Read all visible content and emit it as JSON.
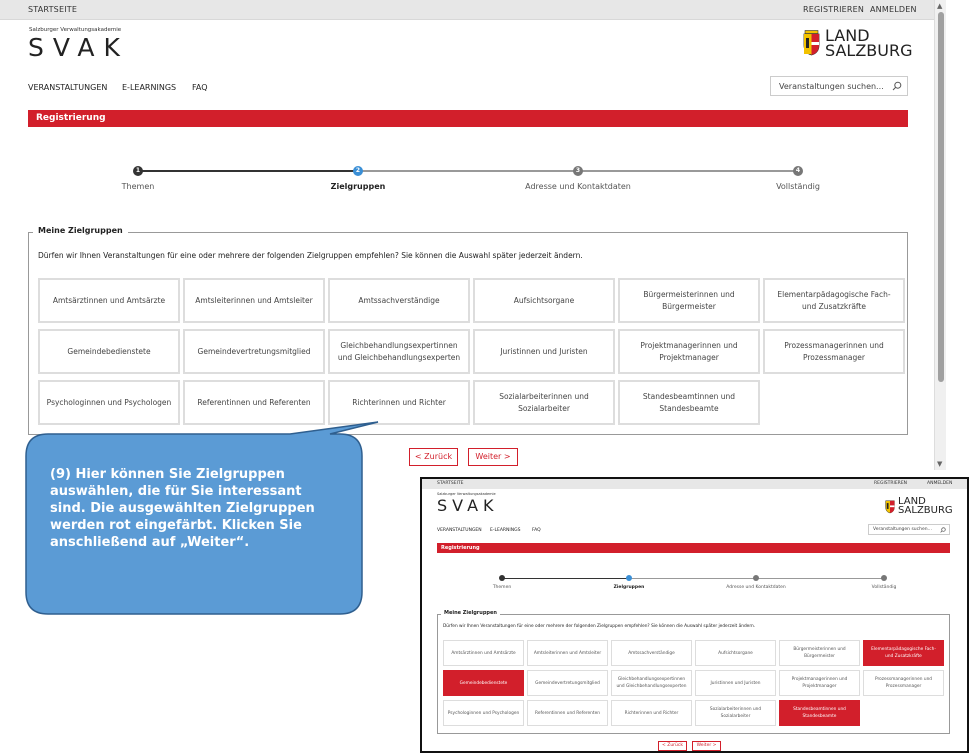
{
  "topbar": {
    "home": "STARTSEITE",
    "register": "REGISTRIEREN",
    "login": "ANMELDEN"
  },
  "logo": {
    "subtitle": "Salzburger Verwaltungsakademie",
    "name": "SVAK"
  },
  "land_logo": {
    "line1": "LAND",
    "line2": "SALZBURG"
  },
  "nav": {
    "items": [
      "VERANSTALTUNGEN",
      "E-LEARNINGS",
      "FAQ"
    ]
  },
  "search": {
    "placeholder": "Veranstaltungen suchen..."
  },
  "section_title": "Registrierung",
  "steps": [
    {
      "num": "1",
      "label": "Themen",
      "state": "done"
    },
    {
      "num": "2",
      "label": "Zielgruppen",
      "state": "active"
    },
    {
      "num": "3",
      "label": "Adresse und Kontaktdaten",
      "state": "todo"
    },
    {
      "num": "4",
      "label": "Vollständig",
      "state": "todo"
    }
  ],
  "fieldset": {
    "legend": "Meine Zielgruppen",
    "intro": "Dürfen wir Ihnen Veranstaltungen für eine oder mehrere der folgenden Zielgruppen empfehlen? Sie können die Auswahl später jederzeit ändern."
  },
  "options": [
    "Amtsärztinnen und Amtsärzte",
    "Amtsleiterinnen und Amtsleiter",
    "Amtssachverständige",
    "Aufsichtsorgane",
    "Bürgermeisterinnen und Bürgermeister",
    "Elementarpädagogische Fach- und Zusatzkräfte",
    "Gemeindebedienstete",
    "Gemeindevertretungsmitglied",
    "Gleichbehandlungsexpertinnen und Gleichbehandlungsexperten",
    "Juristinnen und Juristen",
    "Projektmanagerinnen und Projektmanager",
    "Prozessmanagerinnen und Prozessmanager",
    "Psychologinnen und Psychologen",
    "Referentinnen und Referenten",
    "Richterinnen und Richter",
    "Sozialarbeiterinnen und Sozialarbeiter",
    "Standesbeamtinnen und Standesbeamte"
  ],
  "inset_selected": [
    5,
    6,
    16
  ],
  "buttons": {
    "back": "< Zurück",
    "next": "Weiter >"
  },
  "callout": {
    "text": "(9) Hier können Sie Zielgruppen auswählen, die für Sie interessant sind. Die ausgewählten Zielgruppen werden rot eingefärbt. Klicken Sie anschließend auf „Weiter“."
  },
  "colors": {
    "accent": "#d21f2b",
    "callout": "#5b9bd5",
    "step_done": "#333333",
    "step_active": "#3a8fd6",
    "step_todo": "#777777"
  }
}
